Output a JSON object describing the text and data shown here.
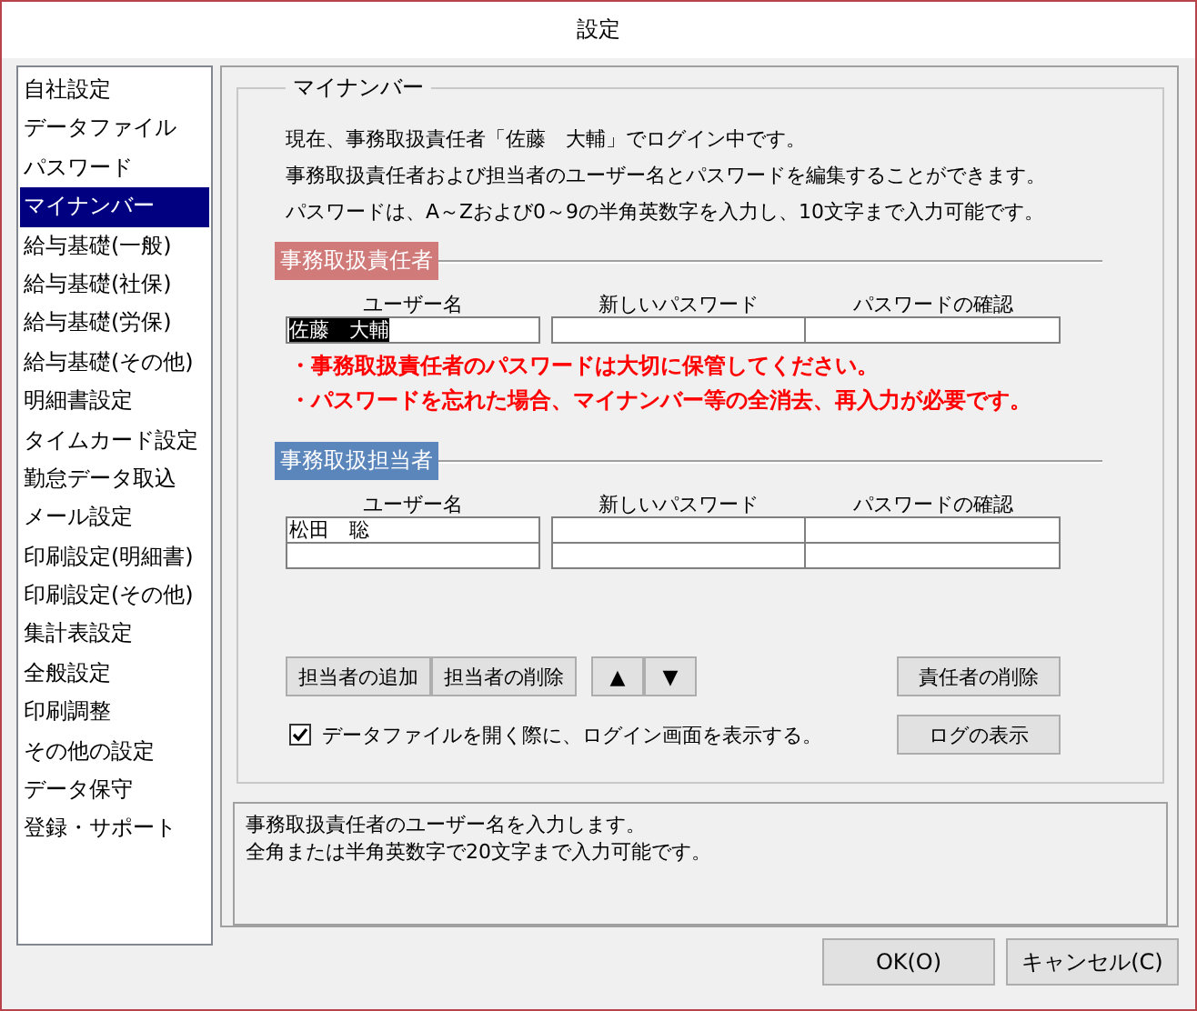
{
  "window": {
    "title": "設定"
  },
  "sidebar": {
    "items": [
      {
        "label": "自社設定",
        "selected": false
      },
      {
        "label": "データファイル",
        "selected": false
      },
      {
        "label": "パスワード",
        "selected": false
      },
      {
        "label": "マイナンバー",
        "selected": true
      },
      {
        "label": "給与基礎(一般)",
        "selected": false
      },
      {
        "label": "給与基礎(社保)",
        "selected": false
      },
      {
        "label": "給与基礎(労保)",
        "selected": false
      },
      {
        "label": "給与基礎(その他)",
        "selected": false
      },
      {
        "label": "明細書設定",
        "selected": false
      },
      {
        "label": "タイムカード設定",
        "selected": false
      },
      {
        "label": "勤怠データ取込",
        "selected": false
      },
      {
        "label": "メール設定",
        "selected": false
      },
      {
        "label": "印刷設定(明細書)",
        "selected": false
      },
      {
        "label": "印刷設定(その他)",
        "selected": false
      },
      {
        "label": "集計表設定",
        "selected": false
      },
      {
        "label": "全般設定",
        "selected": false
      },
      {
        "label": "印刷調整",
        "selected": false
      },
      {
        "label": "その他の設定",
        "selected": false
      },
      {
        "label": "データ保守",
        "selected": false
      },
      {
        "label": "登録・サポート",
        "selected": false
      }
    ]
  },
  "group": {
    "title": "マイナンバー",
    "description": [
      "現在、事務取扱責任者「佐藤　大輔」でログイン中です。",
      "事務取扱責任者および担当者のユーザー名とパスワードを編集することができます。",
      "パスワードは、A～Zおよび0～9の半角英数字を入力し、10文字まで入力可能です。"
    ],
    "sections": [
      {
        "kind": "manager",
        "heading": "事務取扱責任者",
        "color": "#d07a7a",
        "columns": [
          "ユーザー名",
          "新しいパスワード",
          "パスワードの確認"
        ],
        "rows": [
          {
            "user_name": "佐藤　大輔",
            "highlighted": true
          }
        ],
        "warnings": [
          "・事務取扱責任者のパスワードは大切に保管してください。",
          "・パスワードを忘れた場合、マイナンバー等の全消去、再入力が必要です。"
        ]
      },
      {
        "kind": "staff",
        "heading": "事務取扱担当者",
        "color": "#5b86bb",
        "columns": [
          "ユーザー名",
          "新しいパスワード",
          "パスワードの確認"
        ],
        "rows": [
          {
            "user_name": "松田　聡",
            "highlighted": false
          },
          {}
        ]
      }
    ],
    "staff_buttons": [
      "担当者の追加",
      "担当者の削除"
    ],
    "move_buttons": [
      "▲",
      "▼"
    ],
    "delete_manager_button": "責任者の削除",
    "show_log_button": "ログの表示",
    "login_checkbox": {
      "label": "データファイルを開く際に、ログイン画面を表示する。",
      "checked": true
    }
  },
  "help": [
    "事務取扱責任者のユーザー名を入力します。",
    "全角または半角英数字で20文字まで入力可能です。"
  ],
  "footer": {
    "ok": "OK(O)",
    "cancel": "キャンセル(C)"
  }
}
